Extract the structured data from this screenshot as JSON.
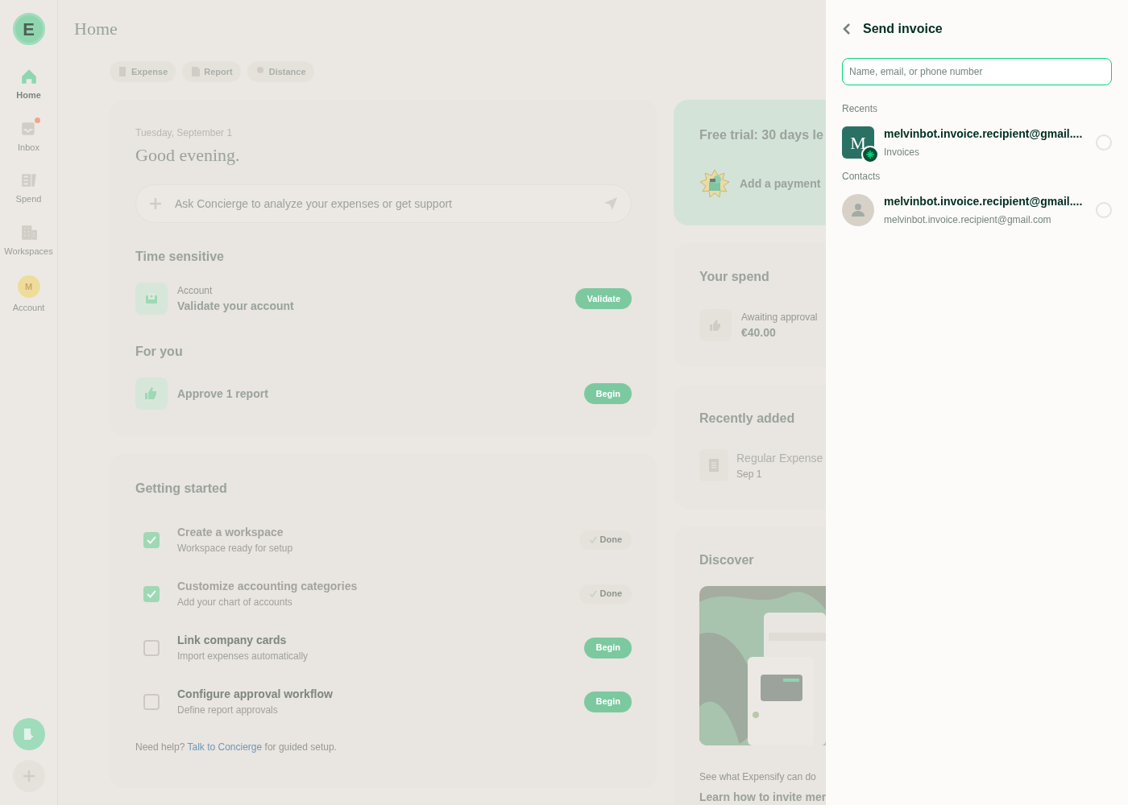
{
  "sidebar": {
    "logo": "E",
    "items": [
      {
        "label": "Home",
        "kind": "home",
        "selected": true,
        "notification": false
      },
      {
        "label": "Inbox",
        "kind": "inbox",
        "selected": false,
        "notification": true
      },
      {
        "label": "Spend",
        "kind": "spend",
        "selected": false,
        "notification": false
      },
      {
        "label": "Workspaces",
        "kind": "workspaces",
        "selected": false,
        "notification": false
      },
      {
        "label": "Account",
        "kind": "avatar",
        "initial": "M",
        "selected": false,
        "notification": false
      }
    ]
  },
  "header": {
    "title": "Home"
  },
  "quick_actions": [
    {
      "label": "Expense",
      "kind": "expense"
    },
    {
      "label": "Report",
      "kind": "report"
    },
    {
      "label": "Distance",
      "kind": "distance"
    }
  ],
  "greeting": {
    "date": "Tuesday, September 1",
    "text": "Good evening."
  },
  "concierge": {
    "placeholder": "Ask Concierge to analyze your expenses or get support"
  },
  "time_sensitive": {
    "title": "Time sensitive",
    "items": [
      {
        "caption": "Account",
        "title": "Validate your account",
        "button": "Validate",
        "kind": "account"
      }
    ]
  },
  "for_you": {
    "title": "For you",
    "items": [
      {
        "title": "Approve 1 report",
        "button": "Begin",
        "kind": "approve"
      }
    ]
  },
  "getting_started": {
    "title": "Getting started",
    "tasks": [
      {
        "title": "Create a workspace",
        "subtitle": "Workspace ready for setup",
        "checked": true,
        "button": "Done"
      },
      {
        "title": "Customize accounting categories",
        "subtitle": "Add your chart of accounts",
        "checked": true,
        "button": "Done"
      },
      {
        "title": "Link company cards",
        "subtitle": "Import expenses automatically",
        "checked": false,
        "button": "Begin"
      },
      {
        "title": "Configure approval workflow",
        "subtitle": "Define report approvals",
        "checked": false,
        "button": "Begin"
      }
    ],
    "help_before": "Need help? ",
    "help_link": "Talk to Concierge",
    "help_after": " for guided setup."
  },
  "trial": {
    "title": "Free trial: 30 days le",
    "action": "Add a payment"
  },
  "spend": {
    "title": "Your spend",
    "caption": "Awaiting approval",
    "amount": "€40.00"
  },
  "recent": {
    "title": "Recently added",
    "items": [
      {
        "title": "Regular Expense",
        "date": "Sep 1"
      }
    ]
  },
  "discover": {
    "title": "Discover",
    "caption": "See what Expensify can do",
    "headline": "Learn how to invite mer"
  },
  "panel": {
    "title": "Send invoice",
    "search": {
      "placeholder": "Name, email, or phone number"
    },
    "sections": [
      {
        "label": "Recents",
        "items": [
          {
            "name": "melvinbot.invoice.recipient@gmail....",
            "detail": "Invoices",
            "kind": "workspace",
            "initial": "M",
            "selected": false
          }
        ]
      },
      {
        "label": "Contacts",
        "items": [
          {
            "name": "melvinbot.invoice.recipient@gmail....",
            "detail": "melvinbot.invoice.recipient@gmail.com",
            "kind": "person",
            "selected": false
          }
        ]
      }
    ]
  }
}
